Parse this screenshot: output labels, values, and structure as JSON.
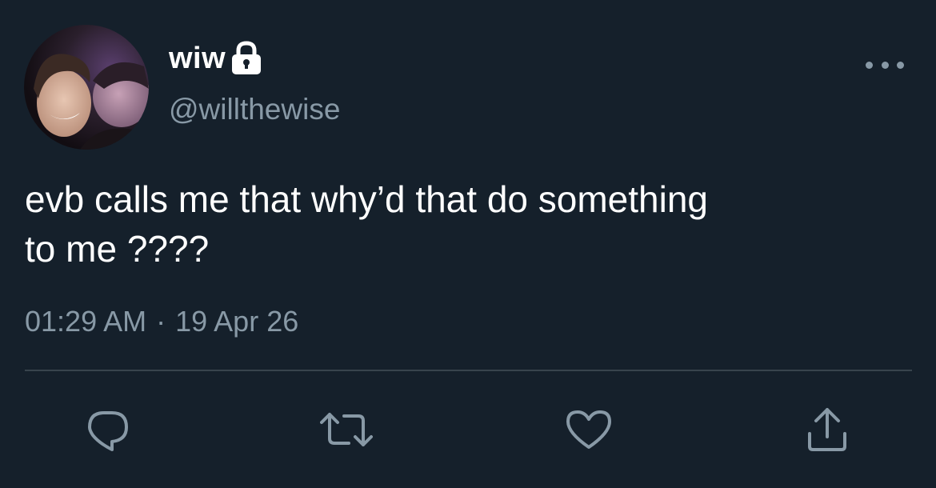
{
  "user": {
    "display_name": "wiw",
    "handle": "@willthewise",
    "avatar_icon": "avatar-photo",
    "protected_icon": "lock-icon"
  },
  "tweet": {
    "text": "evb calls me that why’d that do something\nto me ????",
    "time": "01:29 AM",
    "separator": "·",
    "date": "19 Apr 26"
  },
  "actions": {
    "reply_icon": "reply-icon",
    "retweet_icon": "retweet-icon",
    "like_icon": "heart-icon",
    "share_icon": "share-icon",
    "more_icon": "more-icon"
  },
  "colors": {
    "background": "#15202b",
    "primary_text": "#ffffff",
    "secondary_text": "#8899a6",
    "divider": "#38444d"
  }
}
